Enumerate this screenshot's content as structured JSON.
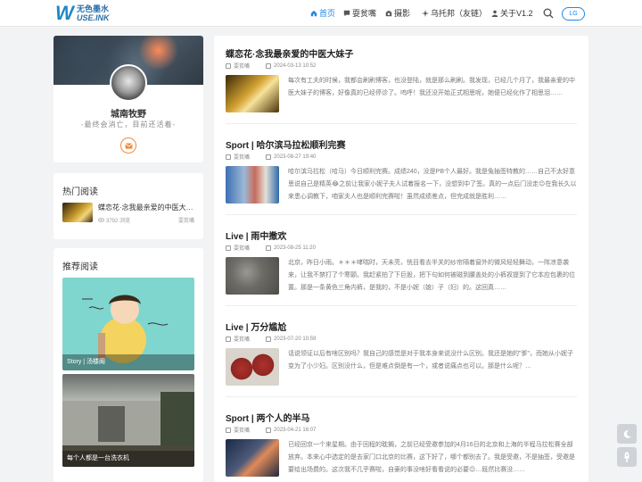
{
  "header": {
    "logo_big": "W",
    "logo_line1": "无色墨水",
    "logo_line2": "USE.INK",
    "nav": [
      {
        "label": "首页",
        "icon": "home-icon",
        "active": true
      },
      {
        "label": "耍贫嘴",
        "icon": "chat-icon",
        "active": false
      },
      {
        "label": "摄影",
        "icon": "camera-icon",
        "active": false
      },
      {
        "label": "乌托邦（友链）",
        "icon": "sparkle-icon",
        "active": false
      },
      {
        "label": "关于V1.2",
        "icon": "user-icon",
        "active": false
      }
    ],
    "search_icon": "search-icon",
    "lang_label": "LG"
  },
  "profile": {
    "name": "城南牧野",
    "motto": "-最终会消亡，目前还活着-",
    "mail_icon": "mail-icon"
  },
  "hot": {
    "title": "热门阅读",
    "item": {
      "title": "蝶恋花·念我最亲爱的中医大妹子",
      "views": "3792 浏览",
      "author": "耍贫嘴"
    }
  },
  "recommended": {
    "title": "推荐阅读",
    "items": [
      {
        "caption": "Story | 汤楼阁"
      },
      {
        "caption": "每个人都是一台洗衣机"
      }
    ]
  },
  "posts": [
    {
      "title": "蝶恋花·念我最亲爱的中医大妹子",
      "author": "耍贫嘴",
      "date": "2024-03-13 10:52",
      "excerpt": "每次有工夫的时候，我都会刷刷博客，也没登陆，就是那么刷刷。我发现，已经几个月了，我最亲爱的中医大妹子的博客，好像真的已经停诊了。呜呼！我还没开始正式相思呢，她便已经化作了相思泪……"
    },
    {
      "title": "Sport | 哈尔滨马拉松顺利完赛",
      "author": "耍贫嘴",
      "date": "2023-08-27 19:40",
      "excerpt": "哈尔滨马拉松（哈马）今日顺利完赛。成绩240，没是PB个人最好。我是兔抽签特教的……自己不太好意思说自己是精英😂之前让我家小妮子夫人试着报名一下，没想到中了签。真的一点后门没走😉在我长久以来患心调教下，咱家夫人也是顺利完赛啦！虽然成绩差点，但完成就是胜利……"
    },
    {
      "title": "Live | 雨中撒欢",
      "author": "耍贫嘴",
      "date": "2023-08-25 11:20",
      "excerpt": "北京，昨日小雨。＊＊＊哮喘时，天未亮，恍目看去半关的纱帘隔着窗外的微风轻轻舞动，一阵凉意袭来，让我不禁打了个寒颤。我赶紧拍了下巨股，把下句如何被磁到腰盖处的小裤衩提到了它本应包裹的位置。那是一条黄色三角内裤，是我的，不是小妮（媳）子（妇）的。这回真……"
    },
    {
      "title": "Live | 万分尴尬",
      "author": "耍贫嘴",
      "date": "2023-07-20 10:59",
      "excerpt": "话说领证以后有啥区别吗？我自己的感觉是对于我本身来说没什么区别。我还是她的\"爹\"，而她从小妮子变为了小少妇。区别没什么，但是难点倒是有一个，或者说痛点也可以。那是什么呢？…"
    },
    {
      "title": "Sport | 两个人的半马",
      "author": "耍贫嘴",
      "date": "2023-04-21 16:07",
      "excerpt": "已经回京一个来星期。由于回程的耽搁，之前已经受邀参加的4月16日的北京和上海的半程马拉松赛全部放弃。本来心中选定的是去家门口北京的比赛，这下好了，哪个都别去了。我是受邀，不是抽签，受邀是要给出场费的。这次我不几乎赛啦，自豪的事没啥好看看说的必要😉…既然比赛没……"
    }
  ],
  "float": [
    {
      "icon": "moon-icon"
    },
    {
      "icon": "rocket-icon"
    }
  ]
}
